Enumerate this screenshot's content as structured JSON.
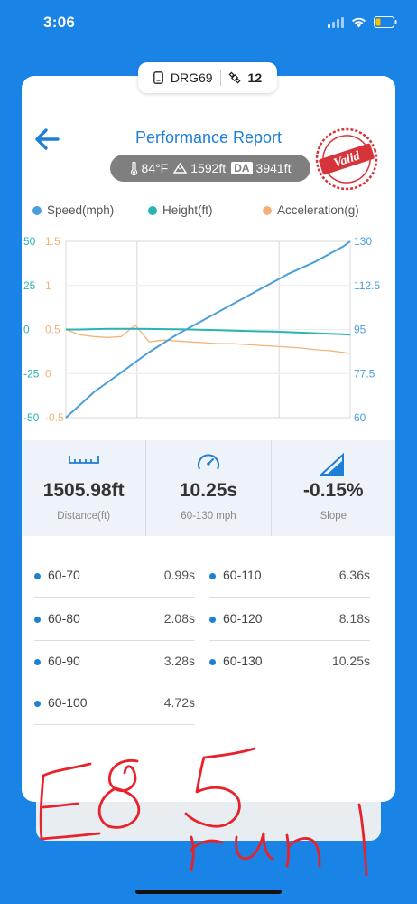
{
  "status": {
    "time": "3:06"
  },
  "device": {
    "name": "DRG69",
    "satellites": "12"
  },
  "header": {
    "title": "Performance Report",
    "stamp_text": "Valid"
  },
  "conditions": {
    "temp": "84°F",
    "altitude": "1592ft",
    "da_label": "DA",
    "density_altitude": "3941ft"
  },
  "legend": {
    "speed": "Speed(mph)",
    "height": "Height(ft)",
    "accel": "Acceleration(g)"
  },
  "colors": {
    "speed": "#4A9FDB",
    "height": "#2BB3B3",
    "accel": "#F2B27A",
    "brand": "#1A83E6"
  },
  "chart_data": {
    "type": "line",
    "axes": {
      "height_ticks": [
        "50",
        "25",
        "0",
        "-25",
        "-50"
      ],
      "accel_ticks": [
        "1.5",
        "1",
        "0.5",
        "0",
        "-0.5"
      ],
      "speed_ticks": [
        "130",
        "112.5",
        "95",
        "77.5",
        "60"
      ]
    },
    "ylim_speed": [
      60,
      130
    ],
    "ylim_height": [
      -50,
      50
    ],
    "ylim_accel": [
      -0.5,
      1.5
    ],
    "x": [
      0,
      0.5,
      1,
      1.5,
      2,
      2.5,
      3,
      3.5,
      4,
      4.5,
      5,
      5.5,
      6,
      6.5,
      7,
      7.5,
      8,
      8.5,
      9,
      9.5,
      10,
      10.25
    ],
    "series": [
      {
        "name": "Speed(mph)",
        "values": [
          60,
          65,
          70,
          74,
          78,
          82,
          86,
          89.5,
          93,
          96,
          99,
          102,
          105,
          108,
          111,
          114,
          117,
          119.5,
          122,
          125,
          128,
          130
        ]
      },
      {
        "name": "Height(ft)",
        "values": [
          0,
          0,
          0.2,
          0.4,
          0.4,
          0.4,
          0.3,
          0.2,
          0.1,
          0,
          -0.2,
          -0.4,
          -0.6,
          -0.8,
          -1,
          -1.2,
          -1.5,
          -1.8,
          -2.1,
          -2.4,
          -2.7,
          -2.9
        ]
      },
      {
        "name": "Acceleration(g)",
        "values": [
          0.5,
          0.44,
          0.42,
          0.41,
          0.42,
          0.55,
          0.36,
          0.38,
          0.37,
          0.36,
          0.35,
          0.34,
          0.34,
          0.33,
          0.32,
          0.31,
          0.3,
          0.29,
          0.27,
          0.26,
          0.24,
          0.23
        ]
      }
    ],
    "grid": true
  },
  "stats": {
    "distance": {
      "value": "1505.98ft",
      "label": "Distance(ft)"
    },
    "time": {
      "value": "10.25s",
      "label": "60-130 mph"
    },
    "slope": {
      "value": "-0.15%",
      "label": "Slope"
    }
  },
  "splits": {
    "left": [
      {
        "label": "60-70",
        "time": "0.99s"
      },
      {
        "label": "60-80",
        "time": "2.08s"
      },
      {
        "label": "60-90",
        "time": "3.28s"
      },
      {
        "label": "60-100",
        "time": "4.72s"
      }
    ],
    "right": [
      {
        "label": "60-110",
        "time": "6.36s"
      },
      {
        "label": "60-120",
        "time": "8.18s"
      },
      {
        "label": "60-130",
        "time": "10.25s"
      }
    ]
  }
}
